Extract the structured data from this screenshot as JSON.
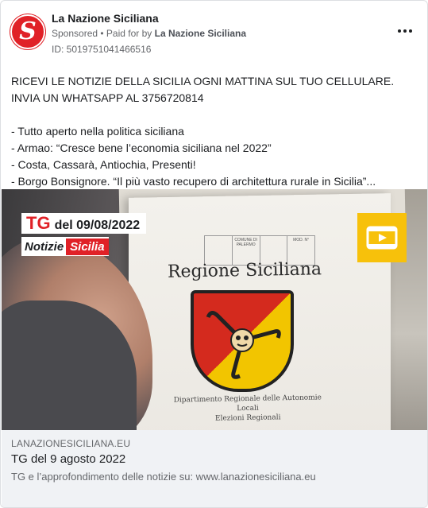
{
  "page": {
    "name": "La Nazione Siciliana",
    "avatar_letter": "S",
    "sponsored": "Sponsored",
    "paid_for_prefix": "• Paid for by",
    "paid_for_name": "La Nazione Siciliana",
    "ad_id": "ID: 5019751041466516"
  },
  "post": {
    "intro": "RICEVI LE NOTIZIE DELLA SICILIA OGNI MATTINA SUL TUO CELLULARE. INVIA UN WHATSAPP AL 3756720814",
    "bullets": [
      "- Tutto aperto nella politica siciliana",
      "- Armao: “Cresce bene l’economia siciliana nel 2022”",
      "- Costa, Cassarà, Antiochia, Presenti!",
      "- Borgo Bonsignore. “Il più vasto recupero di architettura rurale in Sicilia”..."
    ]
  },
  "media": {
    "tg_label": "TG",
    "tg_date": "del 09/08/2022",
    "brand_part1": "Notizie",
    "brand_part2": "Sicilia",
    "box_title": "Regione Siciliana",
    "box_caption_line1": "Dipartimento Regionale delle Autonomie Locali",
    "box_caption_line2": "Elezioni Regionali",
    "stamp_cells": [
      "",
      "COMUNE DI PALERMO",
      "",
      "MOD. N°"
    ],
    "play_icon": "video-play-icon",
    "colors": {
      "brand_red": "#e02127",
      "play_yellow": "#f7c10b"
    }
  },
  "link": {
    "domain": "LANAZIONESICILIANA.EU",
    "title": "TG del 9 agosto 2022",
    "description": "TG e l’approfondimento delle notizie su: www.lanazionesiciliana.eu"
  }
}
